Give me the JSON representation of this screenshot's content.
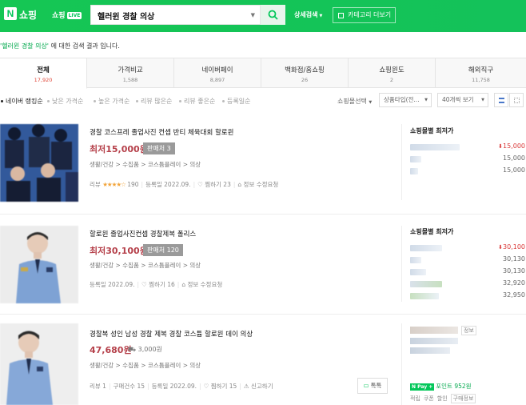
{
  "header": {
    "logo_letter": "N",
    "logo_text": "쇼핑",
    "live_text": "쇼핑",
    "live_badge": "LIVE",
    "search_value": "헬러윈 경찰 의상",
    "detail_search": "상세검색",
    "category_btn": "카테고리 더보기"
  },
  "result": {
    "query": "'헬러윈 경찰 의상'",
    "suffix": "에 대한 검색 결과 입니다."
  },
  "tabs": [
    {
      "label": "전체",
      "count": "17,920",
      "active": true
    },
    {
      "label": "가격비교",
      "count": "1,588",
      "active": false
    },
    {
      "label": "네이버페이",
      "count": "8,897",
      "active": false
    },
    {
      "label": "백화점/홈쇼핑",
      "count": "26",
      "active": false
    },
    {
      "label": "쇼핑윈도",
      "count": "2",
      "active": false
    },
    {
      "label": "해외직구",
      "count": "11,758",
      "active": false
    }
  ],
  "sort": {
    "items": [
      {
        "label": "네이버 랭킹순",
        "active": true
      },
      {
        "label": "낮은 가격순",
        "active": false
      },
      {
        "label": "높은 가격순",
        "active": false
      },
      {
        "label": "리뷰 많은순",
        "active": false
      },
      {
        "label": "리뷰 좋은순",
        "active": false
      },
      {
        "label": "등록일순",
        "active": false
      }
    ],
    "filter_label": "쇼핑몰선택",
    "product_type": "상품타입(전...",
    "page_size": "40개씩 보기"
  },
  "products": [
    {
      "title": "경찰 코스프레 졸업사진 컨셉 반티 체육대회 할로윈",
      "price_prefix": "최저",
      "price": "15,000원",
      "seller": "판매처 3",
      "crumb": "생활/건강 > 수집품 > 코스튬플레이 > 의상",
      "review_label": "리뷰",
      "stars": "★★★★☆",
      "review_count": "190",
      "date": "등록일 2022.09.",
      "wish": "찜하기 23",
      "report": "정보 수정요청",
      "mall_title": "쇼핑몰별 최저가",
      "mall_prices": [
        "15,000",
        "15,000",
        "15,000"
      ]
    },
    {
      "title": "할로윈 졸업사진컨셉 경찰제복 폴리스",
      "price_prefix": "최저",
      "price": "30,100원",
      "seller": "판매처 120",
      "crumb": "생활/건강 > 수집품 > 코스튬플레이 > 의상",
      "date": "등록일 2022.09.",
      "wish": "찜하기 16",
      "report": "정보 수정요청",
      "mall_title": "쇼핑몰별 최저가",
      "mall_prices": [
        "30,100",
        "30,130",
        "30,130",
        "32,920",
        "32,950"
      ]
    },
    {
      "title": "경찰복 성인 남성 경찰 제복 경찰 코스튬 할로윈 데이 의상",
      "price": "47,680원",
      "shipping": "3,000원",
      "crumb": "생활/건강 > 수집품 > 코스튬플레이 > 의상",
      "review": "리뷰 1",
      "purchase": "구매건수 15",
      "date": "등록일 2022.09.",
      "wish": "찜하기 15",
      "report": "신고하기",
      "talk": "톡톡",
      "info_tag": "정보",
      "npay_badge": "N Pay +",
      "point": "포인트 952원",
      "tags": [
        "적립",
        "쿠폰",
        "할인",
        "구매정보"
      ]
    }
  ],
  "colors": {
    "header_green": "#15c654",
    "accent_green": "#03c75a",
    "price_red": "#b5404a"
  }
}
